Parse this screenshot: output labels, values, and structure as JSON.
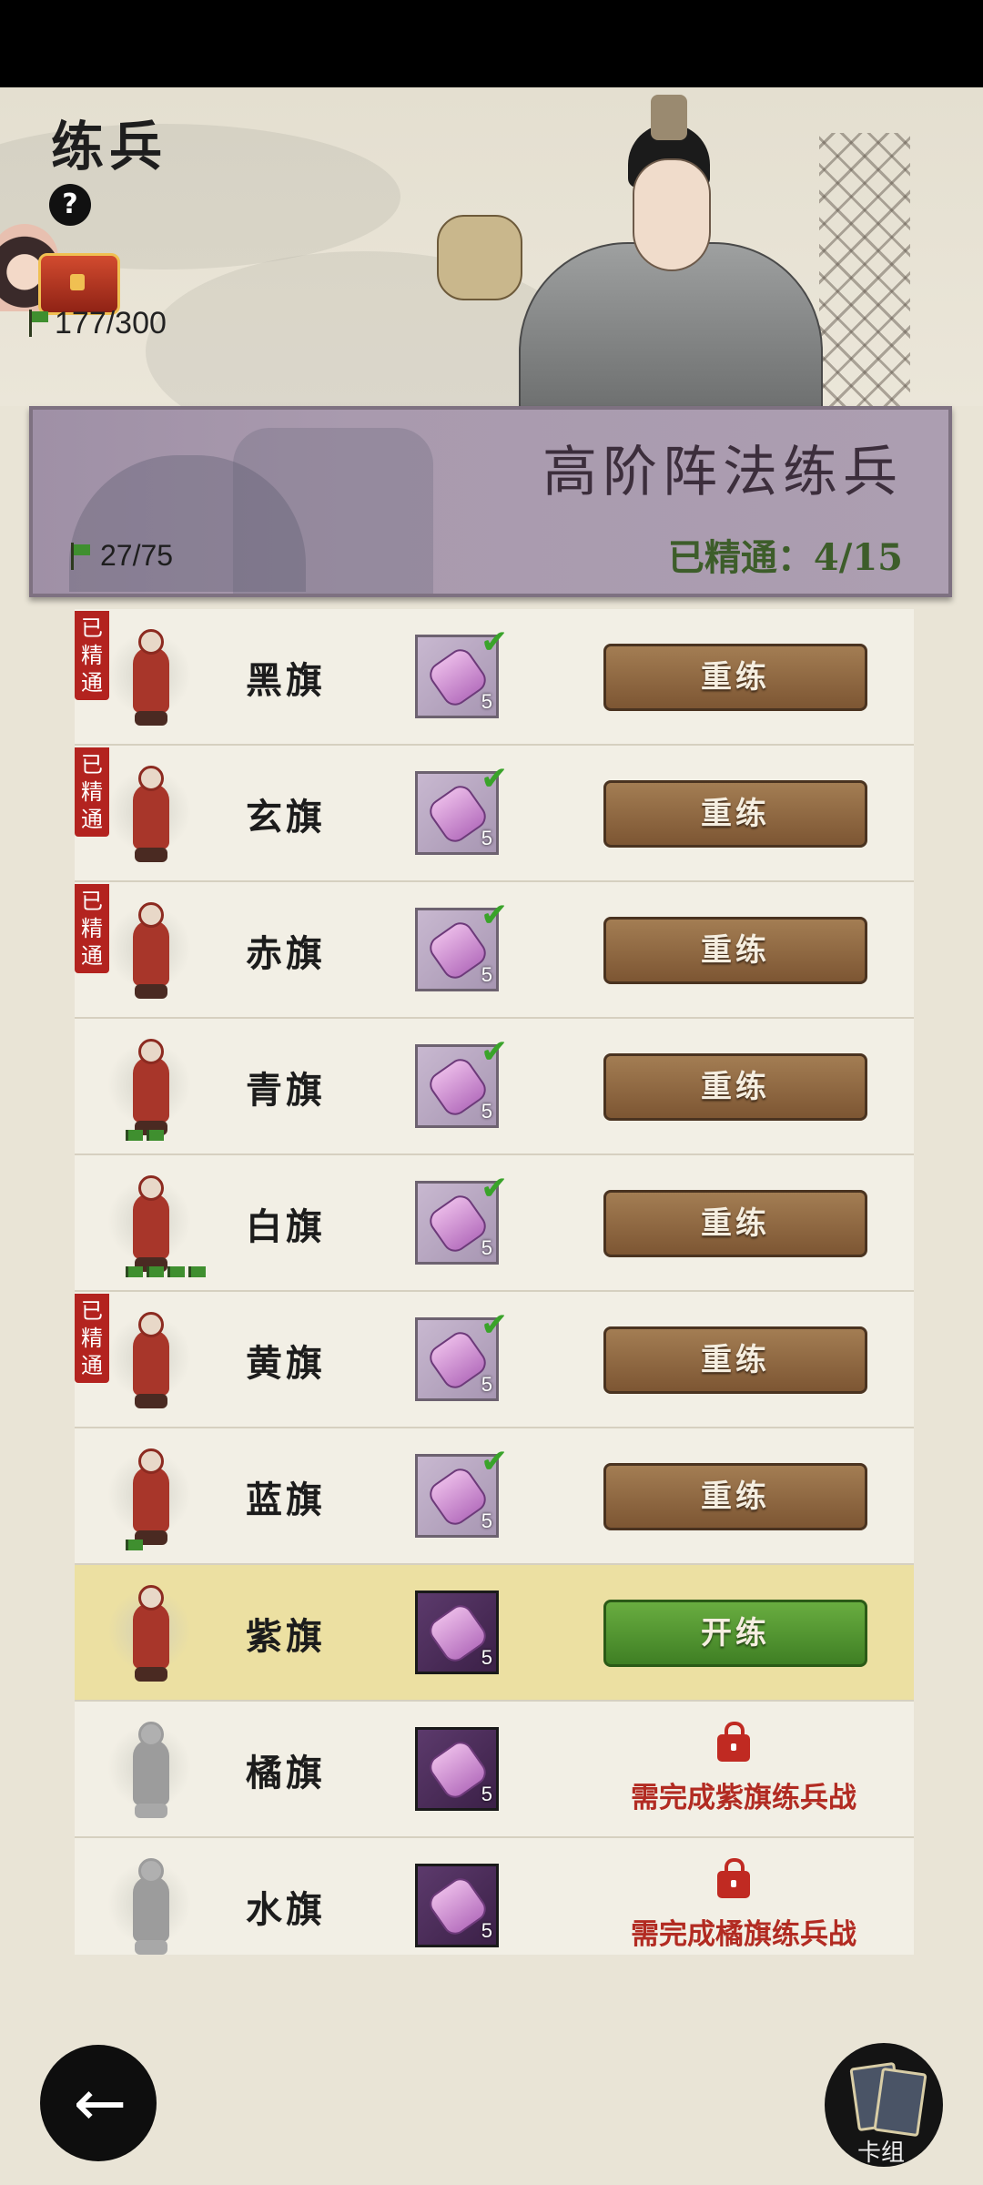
{
  "header": {
    "title": "练兵",
    "help": "?",
    "stamina": "177/300"
  },
  "banner": {
    "title": "高阶阵法练兵",
    "mastered_label": "已精通：",
    "mastered_value": "4/15",
    "flag_count": "27/75"
  },
  "badge_text": [
    "已",
    "精",
    "通"
  ],
  "rows": [
    {
      "name": "黑旗",
      "mastered": true,
      "qty": "5",
      "checked": true,
      "action": "重练",
      "state": "done"
    },
    {
      "name": "玄旗",
      "mastered": true,
      "qty": "5",
      "checked": true,
      "action": "重练",
      "state": "done"
    },
    {
      "name": "赤旗",
      "mastered": true,
      "qty": "5",
      "checked": true,
      "action": "重练",
      "state": "done"
    },
    {
      "name": "青旗",
      "mastered": false,
      "qty": "5",
      "checked": true,
      "action": "重练",
      "state": "done",
      "flags": 2
    },
    {
      "name": "白旗",
      "mastered": false,
      "qty": "5",
      "checked": true,
      "action": "重练",
      "state": "done",
      "flags": 4
    },
    {
      "name": "黄旗",
      "mastered": true,
      "qty": "5",
      "checked": true,
      "action": "重练",
      "state": "done"
    },
    {
      "name": "蓝旗",
      "mastered": false,
      "qty": "5",
      "checked": true,
      "action": "重练",
      "state": "done",
      "flags": 1
    },
    {
      "name": "紫旗",
      "mastered": false,
      "qty": "5",
      "checked": false,
      "action": "开练",
      "state": "current"
    },
    {
      "name": "橘旗",
      "mastered": false,
      "qty": "5",
      "checked": false,
      "requirement": "需完成紫旗练兵战",
      "state": "locked"
    },
    {
      "name": "水旗",
      "mastered": false,
      "qty": "5",
      "checked": false,
      "requirement": "需完成橘旗练兵战",
      "state": "locked"
    }
  ],
  "footer": {
    "back_icon": "←",
    "deck_label": "卡组"
  },
  "colors": {
    "accent_brown": "#8a6540",
    "accent_green": "#4f8f2e",
    "mastered_red": "#b3231f",
    "banner_purple": "#a99aae"
  }
}
